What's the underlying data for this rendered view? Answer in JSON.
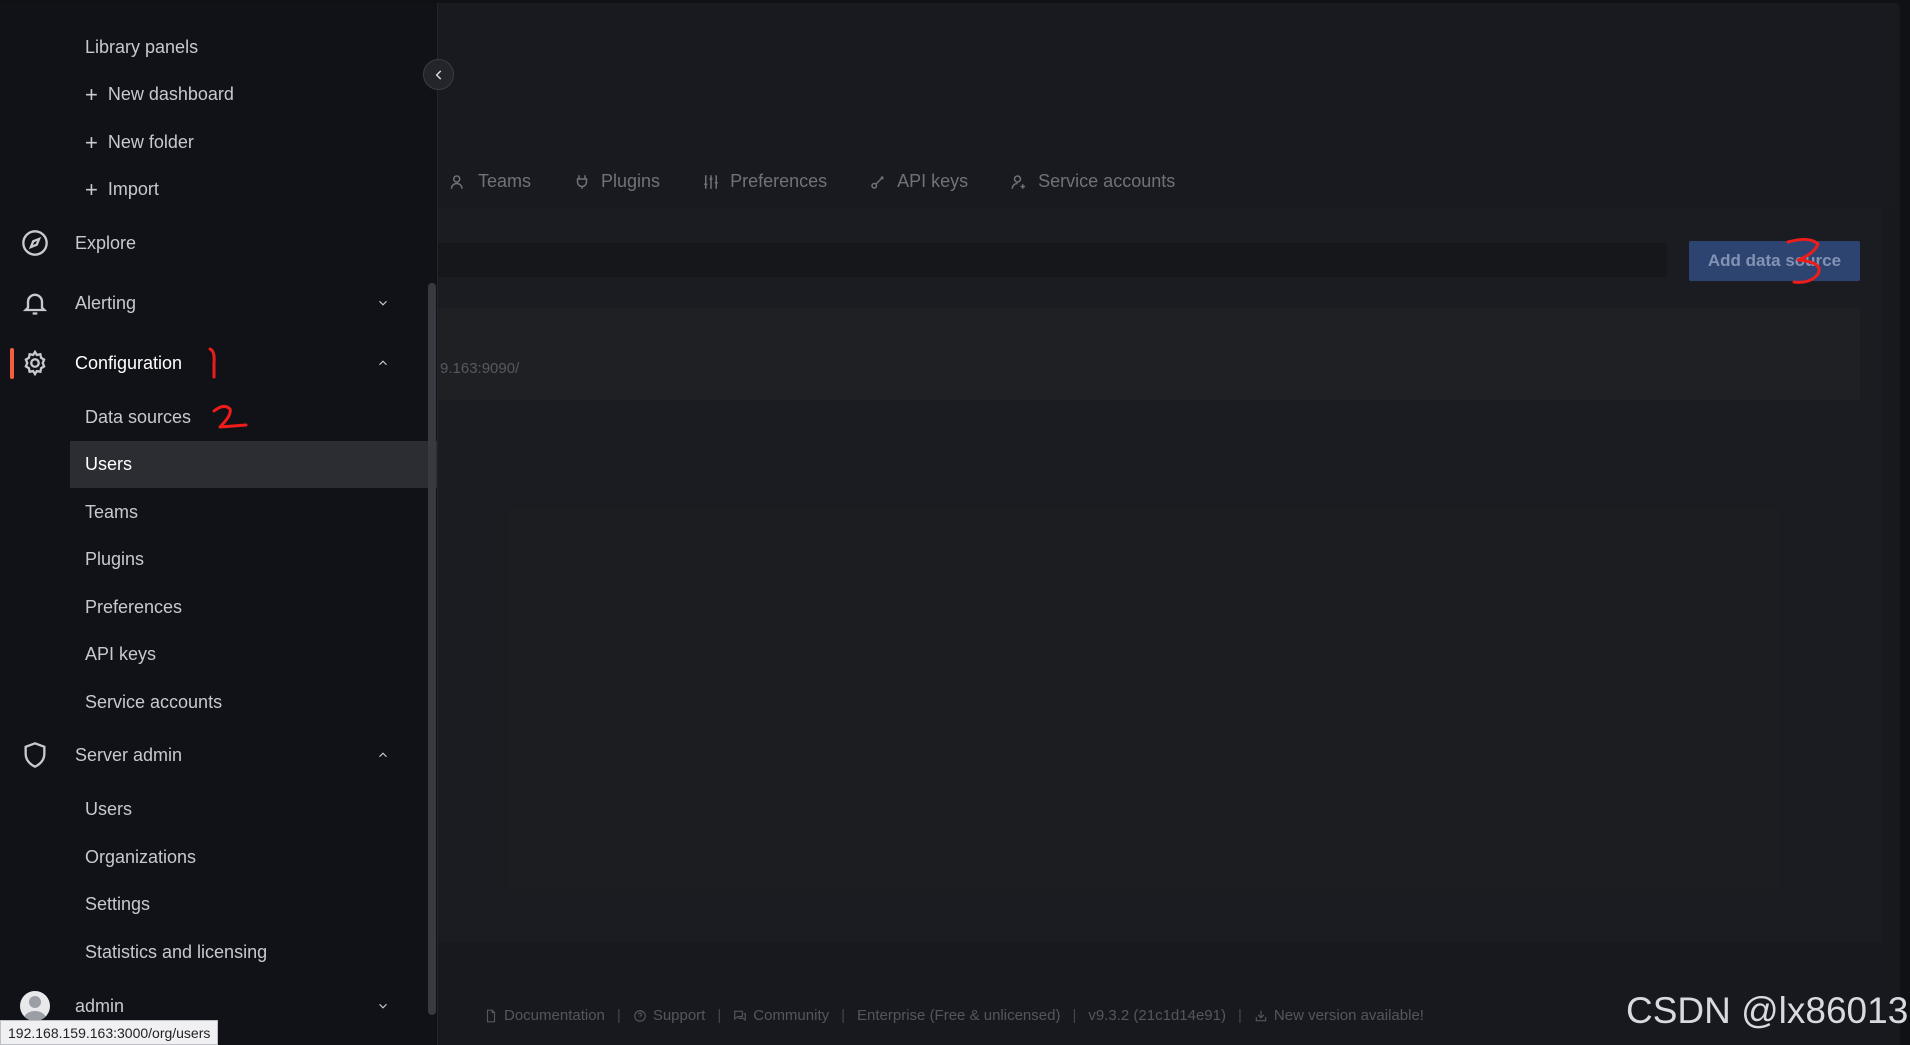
{
  "background_page": {
    "tabs": [
      {
        "label": "Teams",
        "icon": "users-icon"
      },
      {
        "label": "Plugins",
        "icon": "plug-icon"
      },
      {
        "label": "Preferences",
        "icon": "sliders-icon"
      },
      {
        "label": "API keys",
        "icon": "key-icon"
      },
      {
        "label": "Service accounts",
        "icon": "user-cog-icon"
      }
    ],
    "add_button_label": "Add data source",
    "datasource_url": "9.163:9090/",
    "footer": [
      {
        "label": "Documentation",
        "icon": "document-icon"
      },
      {
        "label": "Support",
        "icon": "question-icon"
      },
      {
        "label": "Community",
        "icon": "comments-icon"
      },
      {
        "label": "Enterprise (Free & unlicensed)",
        "icon": ""
      },
      {
        "label": "v9.3.2 (21c1d14e91)",
        "icon": ""
      },
      {
        "label": "New version available!",
        "icon": "download-icon"
      }
    ]
  },
  "sidebar": {
    "dashboards_children": [
      {
        "label": "Library panels",
        "plus": false
      },
      {
        "label": "New dashboard",
        "plus": true
      },
      {
        "label": "New folder",
        "plus": true
      },
      {
        "label": "Import",
        "plus": true
      }
    ],
    "explore": {
      "label": "Explore",
      "icon": "compass-icon"
    },
    "alerting": {
      "label": "Alerting",
      "icon": "bell-icon"
    },
    "configuration": {
      "label": "Configuration",
      "icon": "gear-icon",
      "children": [
        {
          "label": "Data sources"
        },
        {
          "label": "Users",
          "selected": true
        },
        {
          "label": "Teams"
        },
        {
          "label": "Plugins"
        },
        {
          "label": "Preferences"
        },
        {
          "label": "API keys"
        },
        {
          "label": "Service accounts"
        }
      ]
    },
    "server_admin": {
      "label": "Server admin",
      "icon": "shield-icon",
      "children": [
        {
          "label": "Users"
        },
        {
          "label": "Organizations"
        },
        {
          "label": "Settings"
        },
        {
          "label": "Statistics and licensing"
        }
      ]
    },
    "user": {
      "label": "admin"
    }
  },
  "statusbar_url": "192.168.159.163:3000/org/users",
  "watermark": "CSDN @lx86013",
  "colors": {
    "sidebar_bg": "#111217",
    "active_accent": "#f55f3e",
    "primary_button": "#324a7a",
    "annotation": "#ef1c1c"
  }
}
